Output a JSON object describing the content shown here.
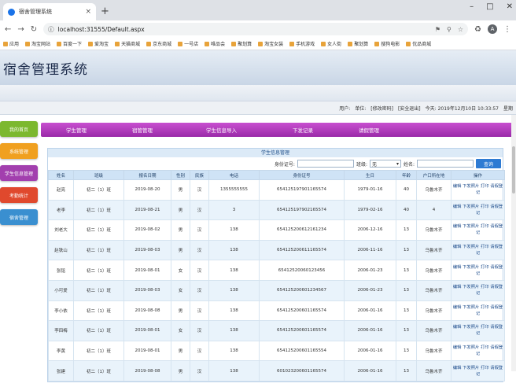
{
  "browser": {
    "tab_title": "宿舍管理系统",
    "tab_close": "×",
    "new_tab": "+",
    "url": "localhost:31555/Default.aspx",
    "avatar": "A",
    "bookmarks": [
      "应用",
      "淘宝网站",
      "百度一下",
      "爱淘宝",
      "天猫商城",
      "京东商城",
      "一号店",
      "唯品会",
      "聚划算",
      "淘宝女装",
      "手机游戏",
      "女人街",
      "聚划算",
      "搜狗电影",
      "优品商城"
    ]
  },
  "site": {
    "title": "宿舍管理系统",
    "userbar": {
      "user_label": "用户:",
      "unit_label": "单位:",
      "change_pwd": "[修改密码]",
      "logout": "[安全退出]",
      "today": "今天: 2019年12月10日 10:33:57",
      "stat": "星期"
    }
  },
  "sidebar": {
    "items": [
      {
        "label": "我的首页",
        "color": "#7cb82f"
      },
      {
        "label": "系统管理",
        "color": "#f0a020"
      },
      {
        "label": "学生信息管理",
        "color": "#a23fae"
      },
      {
        "label": "考勤统计",
        "color": "#e0492d"
      },
      {
        "label": "宿舍管理",
        "color": "#3a8fd0"
      }
    ]
  },
  "nav": {
    "items": [
      "学生管理",
      "宿管管理",
      "学生信息导入",
      "下发记录",
      "请假管理"
    ]
  },
  "panel": {
    "title": "学生信息管理",
    "search": {
      "id_label": "身份证号:",
      "id_value": "",
      "class_label": "班级:",
      "class_value": "无",
      "name_label": "姓名:",
      "name_value": "",
      "button": "查询",
      "dropdown_icon": "triangle-down-icon"
    }
  },
  "table": {
    "headers": [
      "姓名",
      "班级",
      "报名日期",
      "性别",
      "民族",
      "电话",
      "身份证号",
      "生日",
      "年龄",
      "户口所在地",
      "操作"
    ],
    "rows": [
      [
        "赵亮",
        "初二（1）班",
        "2019-08-20",
        "男",
        "汉",
        "1355555555",
        "654125197901165574",
        "1979-01-16",
        "40",
        "乌鲁木齐"
      ],
      [
        "老李",
        "初二（1）班",
        "2019-08-21",
        "男",
        "汉",
        "3",
        "654125197902165574",
        "1979-02-16",
        "40",
        "4"
      ],
      [
        "刘老大",
        "初二（1）班",
        "2019-08-02",
        "男",
        "汉",
        "138",
        "654125200612161234",
        "2006-12-16",
        "13",
        "乌鲁木齐"
      ],
      [
        "赵铁山",
        "初二（1）班",
        "2019-08-03",
        "男",
        "汉",
        "138",
        "654125200611165574",
        "2006-11-16",
        "13",
        "乌鲁木齐"
      ],
      [
        "张铭",
        "初二（1）班",
        "2019-08-01",
        "女",
        "汉",
        "138",
        "65412520060123456",
        "2006-01-23",
        "13",
        "乌鲁木齐"
      ],
      [
        "小可爱",
        "初二（1）班",
        "2019-08-03",
        "女",
        "汉",
        "138",
        "654125200601234567",
        "2006-01-23",
        "13",
        "乌鲁木齐"
      ],
      [
        "李小依",
        "初二（1）班",
        "2019-08-08",
        "男",
        "汉",
        "138",
        "654125200601165574",
        "2006-01-16",
        "13",
        "乌鲁木齐"
      ],
      [
        "李四梅",
        "初二（1）班",
        "2019-08-01",
        "女",
        "汉",
        "138",
        "654125200601165574",
        "2006-01-16",
        "13",
        "乌鲁木齐"
      ],
      [
        "李黄",
        "初二（1）班",
        "2019-08-01",
        "男",
        "汉",
        "138",
        "654125200601165554",
        "2006-01-16",
        "13",
        "乌鲁木齐"
      ],
      [
        "张建",
        "初二（1）班",
        "2019-08-08",
        "男",
        "汉",
        "138",
        "601023200601165574",
        "2006-01-16",
        "13",
        "乌鲁木齐"
      ]
    ],
    "ops": {
      "edit": "编辑",
      "dorm": "下发照片",
      "print": "打印",
      "notice": "请假登记"
    }
  }
}
